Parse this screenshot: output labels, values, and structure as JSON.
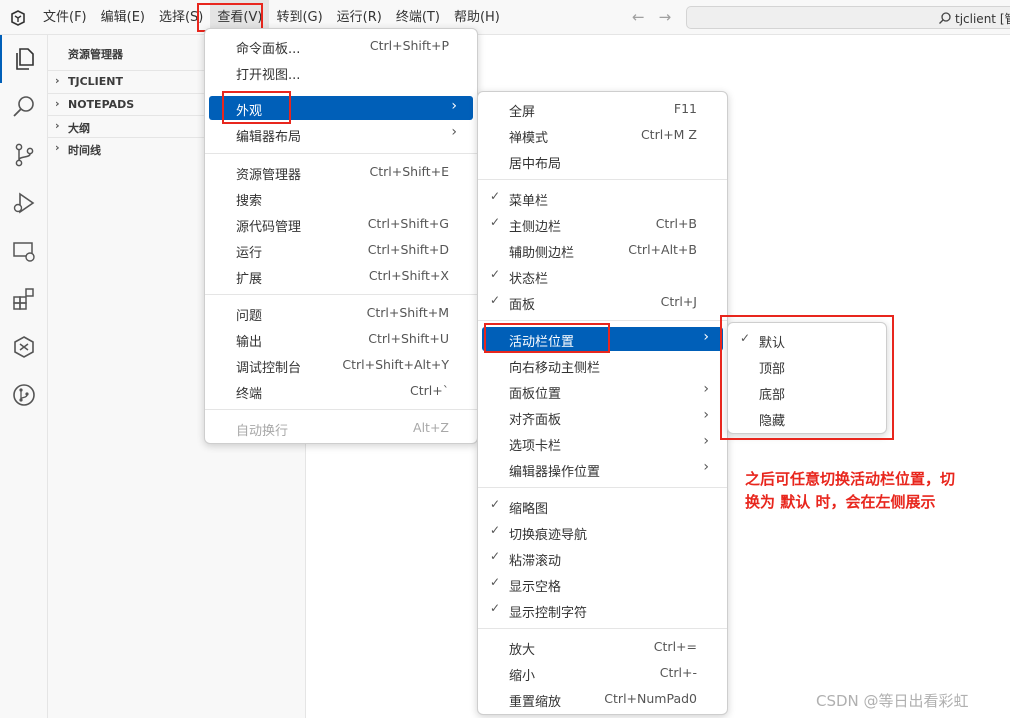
{
  "menubar": {
    "items": [
      {
        "label": "文件(F)"
      },
      {
        "label": "编辑(E)"
      },
      {
        "label": "选择(S)"
      },
      {
        "label": "查看(V)"
      },
      {
        "label": "转到(G)"
      },
      {
        "label": "运行(R)"
      },
      {
        "label": "终端(T)"
      },
      {
        "label": "帮助(H)"
      }
    ],
    "command_center_text": "tjclient [管"
  },
  "sidebar": {
    "title": "资源管理器",
    "sections": [
      {
        "label": "TJCLIENT"
      },
      {
        "label": "NOTEPADS"
      },
      {
        "label": "大纲"
      },
      {
        "label": "时间线"
      }
    ]
  },
  "view_menu": {
    "items": [
      {
        "label": "命令面板...",
        "shortcut": "Ctrl+Shift+P"
      },
      {
        "label": "打开视图...",
        "shortcut": ""
      },
      {
        "label": "外观",
        "shortcut": ""
      },
      {
        "label": "编辑器布局",
        "shortcut": ""
      },
      {
        "label": "资源管理器",
        "shortcut": "Ctrl+Shift+E"
      },
      {
        "label": "搜索",
        "shortcut": ""
      },
      {
        "label": "源代码管理",
        "shortcut": "Ctrl+Shift+G"
      },
      {
        "label": "运行",
        "shortcut": "Ctrl+Shift+D"
      },
      {
        "label": "扩展",
        "shortcut": "Ctrl+Shift+X"
      },
      {
        "label": "问题",
        "shortcut": "Ctrl+Shift+M"
      },
      {
        "label": "输出",
        "shortcut": "Ctrl+Shift+U"
      },
      {
        "label": "调试控制台",
        "shortcut": "Ctrl+Shift+Alt+Y"
      },
      {
        "label": "终端",
        "shortcut": "Ctrl+`"
      },
      {
        "label": "自动换行",
        "shortcut": "Alt+Z"
      }
    ]
  },
  "appearance_menu": {
    "items": [
      {
        "label": "全屏",
        "shortcut": "F11"
      },
      {
        "label": "禅模式",
        "shortcut": "Ctrl+M Z"
      },
      {
        "label": "居中布局",
        "shortcut": ""
      },
      {
        "label": "菜单栏",
        "shortcut": "",
        "checked": true
      },
      {
        "label": "主侧边栏",
        "shortcut": "Ctrl+B",
        "checked": true
      },
      {
        "label": "辅助侧边栏",
        "shortcut": "Ctrl+Alt+B",
        "checked": false
      },
      {
        "label": "状态栏",
        "shortcut": "",
        "checked": true
      },
      {
        "label": "面板",
        "shortcut": "Ctrl+J",
        "checked": true
      },
      {
        "label": "活动栏位置",
        "shortcut": ""
      },
      {
        "label": "向右移动主侧栏",
        "shortcut": ""
      },
      {
        "label": "面板位置",
        "shortcut": ""
      },
      {
        "label": "对齐面板",
        "shortcut": ""
      },
      {
        "label": "选项卡栏",
        "shortcut": ""
      },
      {
        "label": "编辑器操作位置",
        "shortcut": ""
      },
      {
        "label": "缩略图",
        "shortcut": "",
        "checked": true
      },
      {
        "label": "切换痕迹导航",
        "shortcut": "",
        "checked": true
      },
      {
        "label": "粘滞滚动",
        "shortcut": "",
        "checked": true
      },
      {
        "label": "显示空格",
        "shortcut": "",
        "checked": true
      },
      {
        "label": "显示控制字符",
        "shortcut": "",
        "checked": true
      },
      {
        "label": "放大",
        "shortcut": "Ctrl+="
      },
      {
        "label": "缩小",
        "shortcut": "Ctrl+-"
      },
      {
        "label": "重置缩放",
        "shortcut": "Ctrl+NumPad0"
      }
    ]
  },
  "activity_bar_position_menu": {
    "items": [
      {
        "label": "默认",
        "checked": true
      },
      {
        "label": "顶部",
        "checked": false
      },
      {
        "label": "底部",
        "checked": false
      },
      {
        "label": "隐藏",
        "checked": false
      }
    ]
  },
  "annotation": {
    "line1": "之后可任意切换活动栏位置，切",
    "line2": "换为 默认 时，会在左侧展示"
  },
  "watermark": "CSDN @等日出看彩虹",
  "colors": {
    "accent": "#005fb8",
    "highlight_box": "#e8261d",
    "annotation_text": "#e8261d"
  },
  "icons": {
    "app": "vscode-logo-icon",
    "activity_bar": [
      "explorer-icon",
      "search-icon",
      "source-control-icon",
      "run-debug-icon",
      "remote-explorer-icon",
      "extensions-icon",
      "copilot-icon",
      "git-graph-icon"
    ]
  }
}
